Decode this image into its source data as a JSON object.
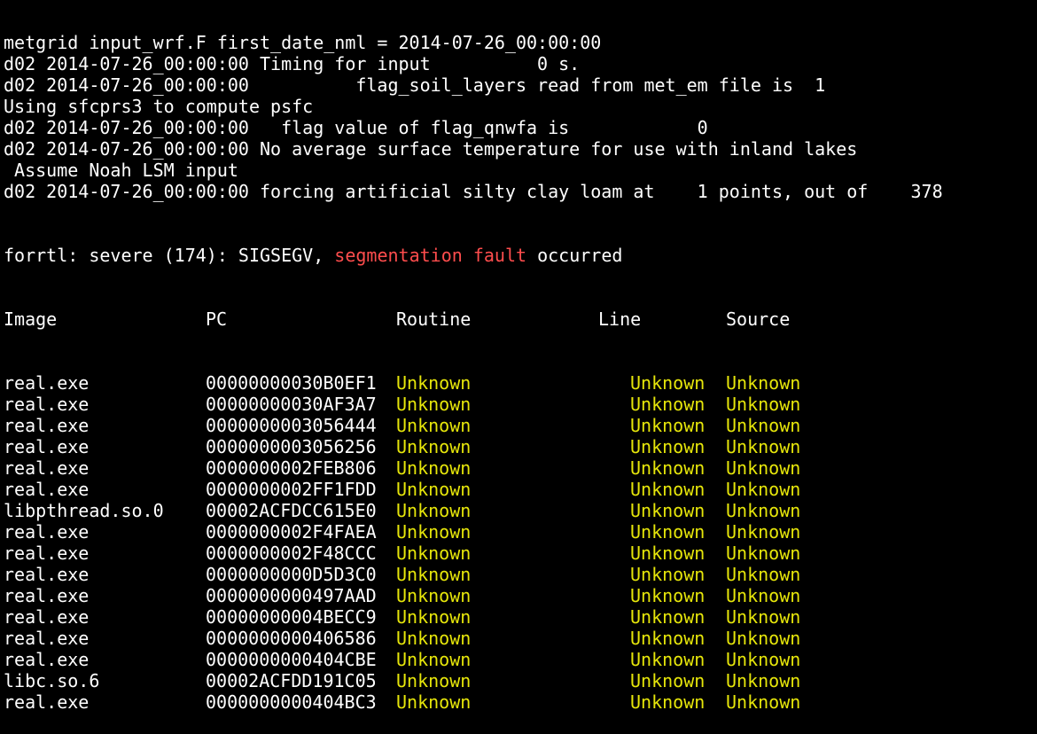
{
  "colors": {
    "background": "#000000",
    "text": "#ffffff",
    "error": "#ff4d4d",
    "unknown": "#e6e60a"
  },
  "log": [
    "metgrid input_wrf.F first_date_nml = 2014-07-26_00:00:00",
    "d02 2014-07-26_00:00:00 Timing for input          0 s.",
    "d02 2014-07-26_00:00:00          flag_soil_layers read from met_em file is  1",
    "Using sfcprs3 to compute psfc",
    "d02 2014-07-26_00:00:00   flag value of flag_qnwfa is            0",
    "d02 2014-07-26_00:00:00 No average surface temperature for use with inland lakes",
    " Assume Noah LSM input",
    "d02 2014-07-26_00:00:00 forcing artificial silty clay loam at    1 points, out of    378"
  ],
  "error_line": {
    "prefix": "forrtl: severe (174): SIGSEGV, ",
    "highlight": "segmentation fault",
    "suffix": " occurred"
  },
  "traceback": {
    "headers": {
      "image": "Image",
      "pc": "PC",
      "routine": "Routine",
      "line": "Line",
      "source": "Source"
    },
    "rows": [
      {
        "image": "real.exe",
        "pc": "00000000030B0EF1",
        "routine": "Unknown",
        "line": "Unknown",
        "source": "Unknown"
      },
      {
        "image": "real.exe",
        "pc": "00000000030AF3A7",
        "routine": "Unknown",
        "line": "Unknown",
        "source": "Unknown"
      },
      {
        "image": "real.exe",
        "pc": "0000000003056444",
        "routine": "Unknown",
        "line": "Unknown",
        "source": "Unknown"
      },
      {
        "image": "real.exe",
        "pc": "0000000003056256",
        "routine": "Unknown",
        "line": "Unknown",
        "source": "Unknown"
      },
      {
        "image": "real.exe",
        "pc": "0000000002FEB806",
        "routine": "Unknown",
        "line": "Unknown",
        "source": "Unknown"
      },
      {
        "image": "real.exe",
        "pc": "0000000002FF1FDD",
        "routine": "Unknown",
        "line": "Unknown",
        "source": "Unknown"
      },
      {
        "image": "libpthread.so.0",
        "pc": "00002ACFDCC615E0",
        "routine": "Unknown",
        "line": "Unknown",
        "source": "Unknown"
      },
      {
        "image": "real.exe",
        "pc": "0000000002F4FAEA",
        "routine": "Unknown",
        "line": "Unknown",
        "source": "Unknown"
      },
      {
        "image": "real.exe",
        "pc": "0000000002F48CCC",
        "routine": "Unknown",
        "line": "Unknown",
        "source": "Unknown"
      },
      {
        "image": "real.exe",
        "pc": "0000000000D5D3C0",
        "routine": "Unknown",
        "line": "Unknown",
        "source": "Unknown"
      },
      {
        "image": "real.exe",
        "pc": "0000000000497AAD",
        "routine": "Unknown",
        "line": "Unknown",
        "source": "Unknown"
      },
      {
        "image": "real.exe",
        "pc": "00000000004BECC9",
        "routine": "Unknown",
        "line": "Unknown",
        "source": "Unknown"
      },
      {
        "image": "real.exe",
        "pc": "0000000000406586",
        "routine": "Unknown",
        "line": "Unknown",
        "source": "Unknown"
      },
      {
        "image": "real.exe",
        "pc": "0000000000404CBE",
        "routine": "Unknown",
        "line": "Unknown",
        "source": "Unknown"
      },
      {
        "image": "libc.so.6",
        "pc": "00002ACFDD191C05",
        "routine": "Unknown",
        "line": "Unknown",
        "source": "Unknown"
      },
      {
        "image": "real.exe",
        "pc": "0000000000404BC3",
        "routine": "Unknown",
        "line": "Unknown",
        "source": "Unknown"
      }
    ]
  }
}
